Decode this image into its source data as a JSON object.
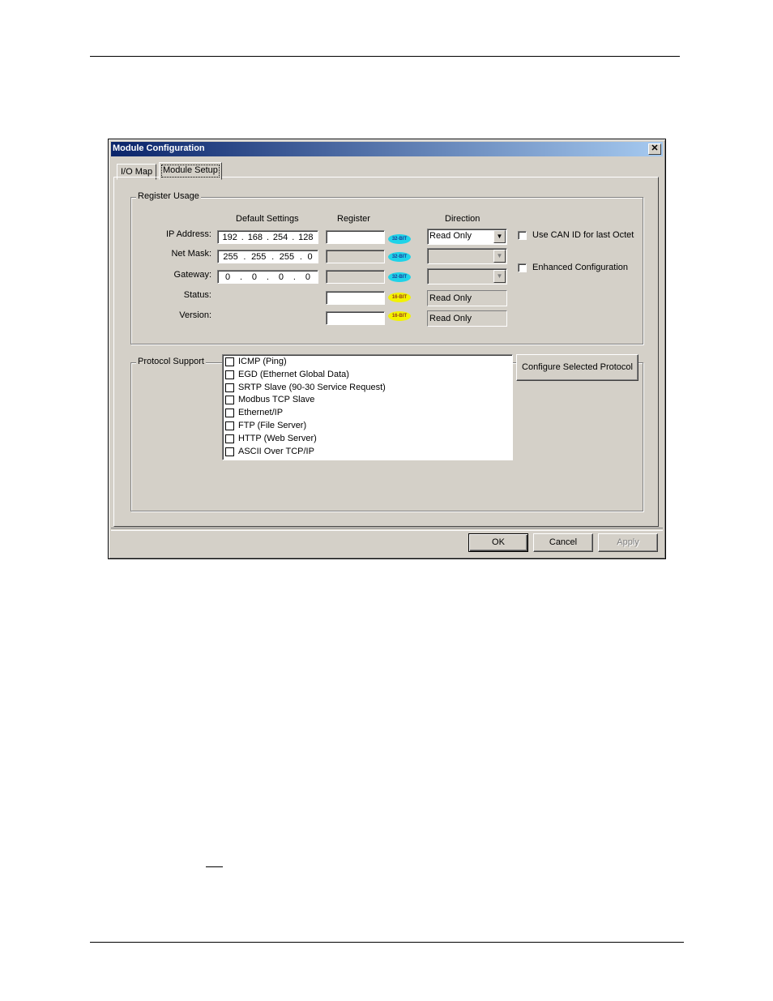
{
  "dialog": {
    "title": "Module Configuration",
    "close_glyph": "✕",
    "tabs": [
      {
        "label": "I/O Map",
        "active": false
      },
      {
        "label": "Module Setup",
        "active": true
      }
    ]
  },
  "register_usage": {
    "legend": "Register Usage",
    "headers": {
      "default_settings": "Default Settings",
      "register": "Register",
      "direction": "Direction"
    },
    "rows": [
      {
        "label": "IP Address:",
        "octets": [
          "192",
          "168",
          "254",
          "128"
        ],
        "register": "",
        "bits": "32-BIT",
        "direction": "Read Only"
      },
      {
        "label": "Net Mask:",
        "octets": [
          "255",
          "255",
          "255",
          "0"
        ],
        "register": "",
        "bits": "32-BIT",
        "direction": ""
      },
      {
        "label": "Gateway:",
        "octets": [
          "0",
          "0",
          "0",
          "0"
        ],
        "register": "",
        "bits": "32-BIT",
        "direction": ""
      },
      {
        "label": "Status:",
        "register": "",
        "bits": "16-BIT",
        "direction": "Read Only"
      },
      {
        "label": "Version:",
        "register": "",
        "bits": "16-BIT",
        "direction": "Read Only"
      }
    ],
    "ip_separator": ".",
    "options": [
      {
        "label": "Use CAN ID for last Octet",
        "checked": false
      },
      {
        "label": "Enhanced Configuration",
        "checked": false
      }
    ]
  },
  "protocol_support": {
    "legend": "Protocol Support",
    "items": [
      {
        "label": "ICMP (Ping)",
        "checked": false
      },
      {
        "label": "EGD (Ethernet Global Data)",
        "checked": false
      },
      {
        "label": "SRTP Slave (90-30 Service Request)",
        "checked": false
      },
      {
        "label": "Modbus TCP Slave",
        "checked": false
      },
      {
        "label": "Ethernet/IP",
        "checked": false
      },
      {
        "label": "FTP (File Server)",
        "checked": false
      },
      {
        "label": "HTTP (Web Server)",
        "checked": false
      },
      {
        "label": "ASCII Over TCP/IP",
        "checked": false
      }
    ],
    "configure_button": "Configure Selected Protocol"
  },
  "buttons": {
    "ok": "OK",
    "cancel": "Cancel",
    "apply": "Apply"
  },
  "colors": {
    "title_start": "#0a246a",
    "title_end": "#a6caf0",
    "badge_32": "#1fd3e8",
    "badge_16": "#f2f200",
    "face": "#d4d0c8"
  }
}
